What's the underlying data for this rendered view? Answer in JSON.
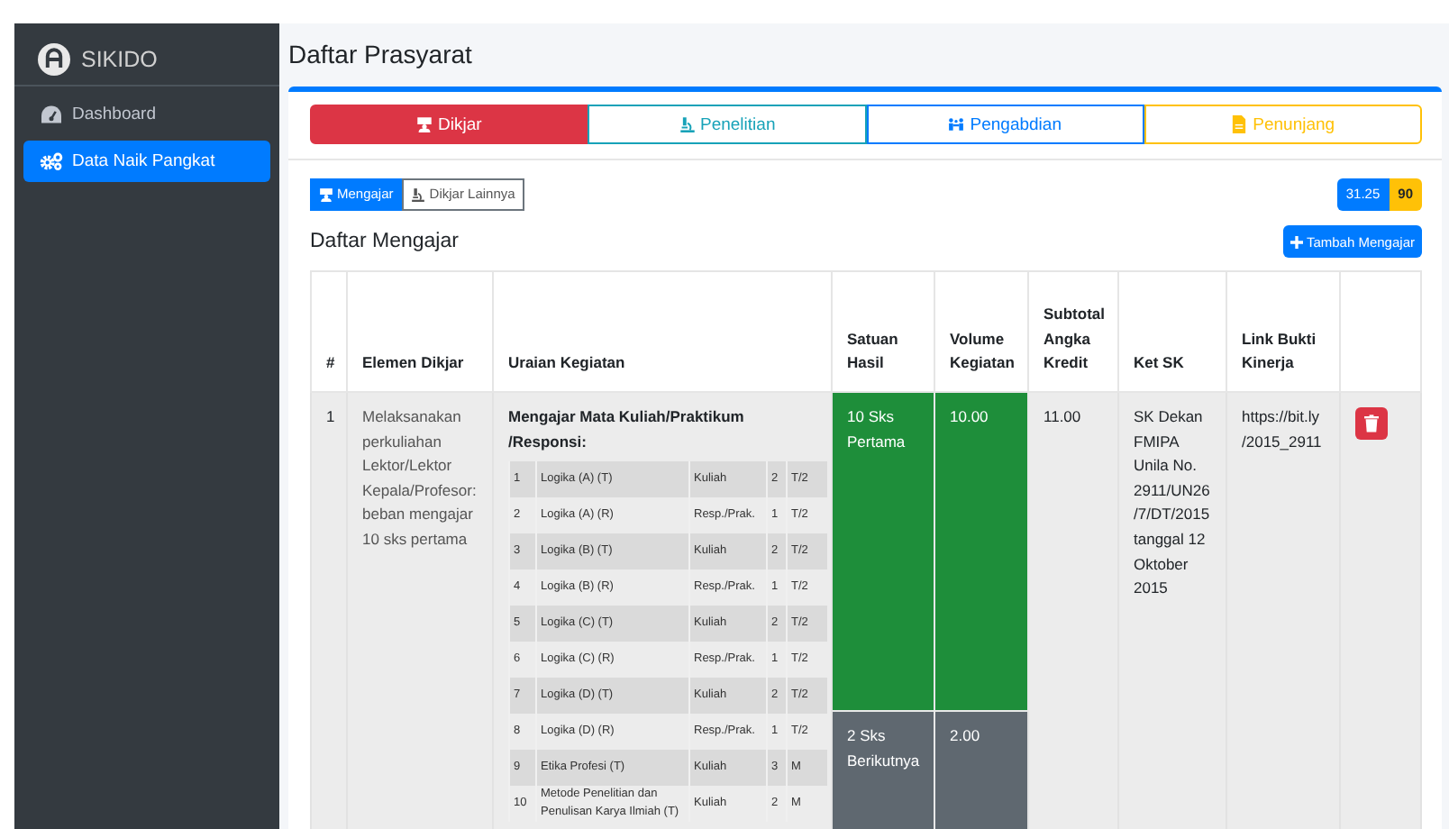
{
  "app": {
    "name": "SIKIDO"
  },
  "sidebar": {
    "items": [
      {
        "label": "Dashboard",
        "kind": "gauge",
        "selected": false
      },
      {
        "label": "Data Naik Pangkat",
        "kind": "cogs",
        "selected": true
      }
    ]
  },
  "page_title": "Daftar Prasyarat",
  "tabs": [
    {
      "label": "Dikjar",
      "kind": "teacher",
      "color": "#dc3545",
      "selected": true
    },
    {
      "label": "Penelitian",
      "kind": "microscope",
      "color": "#17a2b8",
      "selected": false
    },
    {
      "label": "Pengabdian",
      "kind": "people",
      "color": "#007bff",
      "selected": false
    },
    {
      "label": "Penunjang",
      "kind": "file",
      "color": "#ffc107",
      "selected": false
    }
  ],
  "subtabs": [
    {
      "label": "Mengajar",
      "kind": "teacher",
      "selected": true
    },
    {
      "label": "Dikjar Lainnya",
      "kind": "microscope",
      "selected": false
    }
  ],
  "scores": [
    {
      "value": "31.25",
      "color": "#007bff"
    },
    {
      "value": "90",
      "color": "#ffc107"
    }
  ],
  "section_title": "Daftar Mengajar",
  "add_button": "Tambah Mengajar",
  "table": {
    "columns": [
      "#",
      "Elemen Dikjar",
      "Uraian Kegiatan",
      "Satuan Hasil",
      "Volume Kegiatan",
      "Subtotal Angka Kredit",
      "Ket SK",
      "Link Bukti Kinerja"
    ],
    "rows": [
      {
        "no": "1",
        "elemen": "Melaksanakan perkuliahan Lektor/Lektor Kepala/Profesor: beban mengajar 10 sks pertama",
        "uraian_title": "Mengajar Mata Kuliah/Praktikum /Responsi:",
        "courses": [
          {
            "no": "1",
            "name": "Logika (A) (T)",
            "type": "Kuliah",
            "sks": "2",
            "term": "T/2"
          },
          {
            "no": "2",
            "name": "Logika (A) (R)",
            "type": "Resp./Prak.",
            "sks": "1",
            "term": "T/2"
          },
          {
            "no": "3",
            "name": "Logika (B) (T)",
            "type": "Kuliah",
            "sks": "2",
            "term": "T/2"
          },
          {
            "no": "4",
            "name": "Logika (B) (R)",
            "type": "Resp./Prak.",
            "sks": "1",
            "term": "T/2"
          },
          {
            "no": "5",
            "name": "Logika (C) (T)",
            "type": "Kuliah",
            "sks": "2",
            "term": "T/2"
          },
          {
            "no": "6",
            "name": "Logika (C) (R)",
            "type": "Resp./Prak.",
            "sks": "1",
            "term": "T/2"
          },
          {
            "no": "7",
            "name": "Logika (D) (T)",
            "type": "Kuliah",
            "sks": "2",
            "term": "T/2"
          },
          {
            "no": "8",
            "name": "Logika (D) (R)",
            "type": "Resp./Prak.",
            "sks": "1",
            "term": "T/2"
          },
          {
            "no": "9",
            "name": "Etika Profesi (T)",
            "type": "Kuliah",
            "sks": "3",
            "term": "M"
          },
          {
            "no": "10",
            "name": "Metode Penelitian dan Penulisan Karya Ilmiah (T)",
            "type": "Kuliah",
            "sks": "2",
            "term": "M"
          }
        ],
        "tiers": [
          {
            "label": "10 Sks Pertama",
            "volume": "10.00",
            "achieved": true
          },
          {
            "label": "2 Sks Berikutnya",
            "volume": "2.00",
            "achieved": false
          }
        ],
        "subtotal": "11.00",
        "ket_sk": "SK Dekan FMIPA Unila No. 2911/UN26 /7/DT/2015 tanggal 12 Oktober 2015",
        "link": "https://bit.ly /2015_2911"
      }
    ]
  }
}
